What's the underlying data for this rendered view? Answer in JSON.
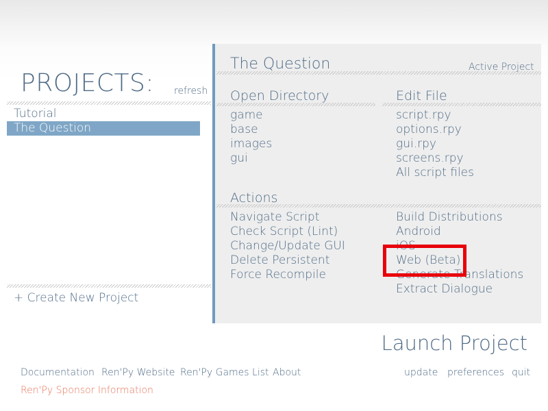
{
  "left": {
    "title": "PROJECTS:",
    "refresh": "refresh",
    "projects": [
      "Tutorial",
      "The Question"
    ],
    "create": "+ Create New Project"
  },
  "panel": {
    "project_name": "The Question",
    "active_label": "Active Project",
    "open_directory": {
      "heading": "Open Directory",
      "items": [
        "game",
        "base",
        "images",
        "gui"
      ]
    },
    "edit_file": {
      "heading": "Edit File",
      "items": [
        "script.rpy",
        "options.rpy",
        "gui.rpy",
        "screens.rpy",
        "All script files"
      ]
    },
    "actions": {
      "heading": "Actions",
      "left_items": [
        "Navigate Script",
        "Check Script (Lint)",
        "Change/Update GUI",
        "Delete Persistent",
        "Force Recompile"
      ],
      "right_items": [
        "Build Distributions",
        "Android",
        "iOS",
        "Web (Beta)",
        "Generate Translations",
        "Extract Dialogue"
      ]
    }
  },
  "launch": "Launch Project",
  "footer": {
    "links": [
      "Documentation",
      "Ren'Py Website",
      "Ren'Py Games List",
      "About"
    ],
    "right_links": [
      "update",
      "preferences",
      "quit"
    ],
    "sponsor": "Ren'Py Sponsor Information"
  },
  "colors": {
    "text": "#4f6b86",
    "selected_bg": "#7fa6c6",
    "panel_bg": "#eeeeee",
    "accent_bar": "#6f9ac0",
    "sponsor": "#e8735a",
    "highlight": "#e8000b"
  }
}
